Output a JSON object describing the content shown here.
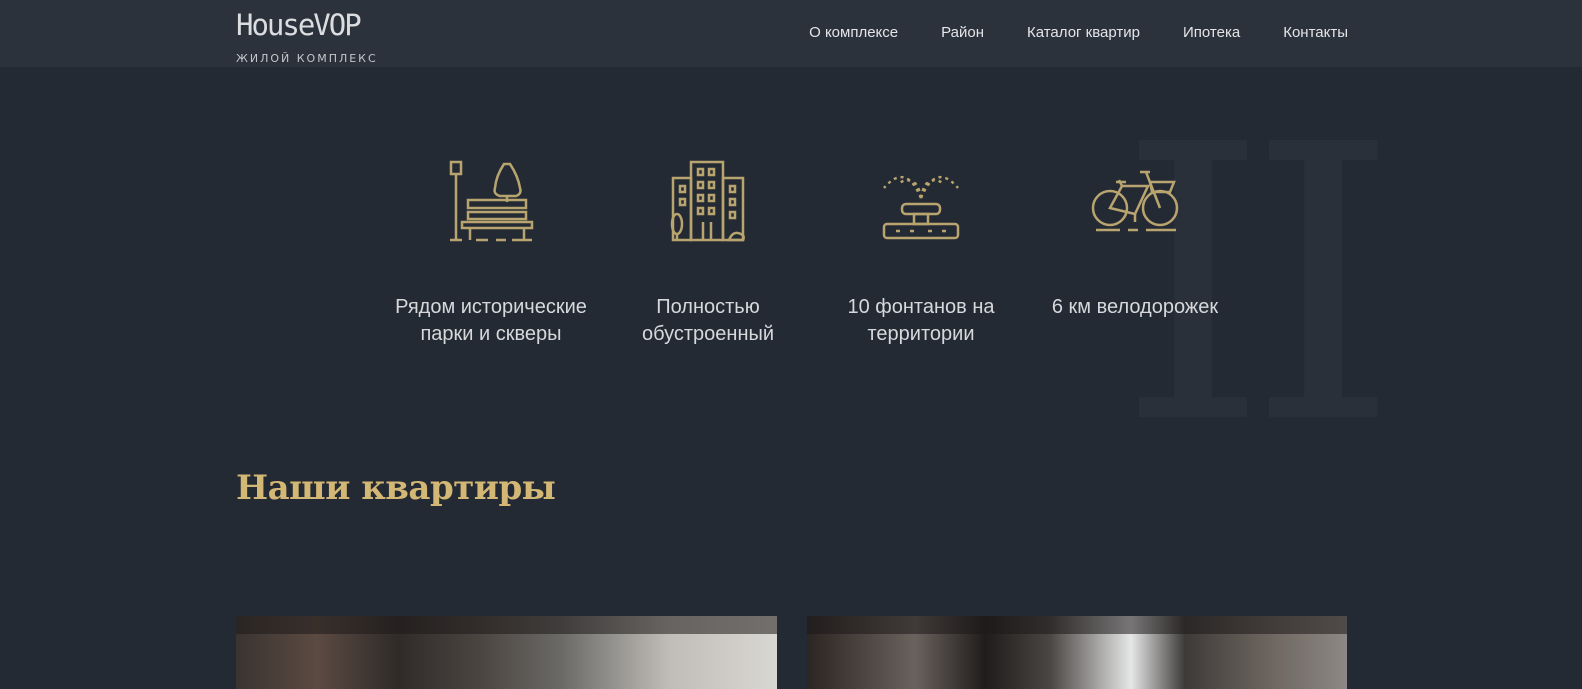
{
  "header": {
    "logo_name": "HouseVOP",
    "logo_sub": "ЖИЛОЙ КОМПЛЕКС",
    "nav": [
      "О комплексе",
      "Район",
      "Каталог квартир",
      "Ипотека",
      "Контакты"
    ]
  },
  "features": [
    {
      "icon": "park-bench-icon",
      "text": "Рядом исторические парки и скверы"
    },
    {
      "icon": "city-buildings-icon",
      "text": "Полностью обустроенный"
    },
    {
      "icon": "fountain-icon",
      "text": "10 фонтанов на территории"
    },
    {
      "icon": "bicycle-icon",
      "text": "6 км велодорожек"
    }
  ],
  "section": {
    "title": "Наши квартиры"
  },
  "decor": {
    "numeral": "II"
  },
  "colors": {
    "background": "#242a33",
    "header": "#2c323b",
    "accent": "#d3b774",
    "icon": "#b8a46f"
  }
}
